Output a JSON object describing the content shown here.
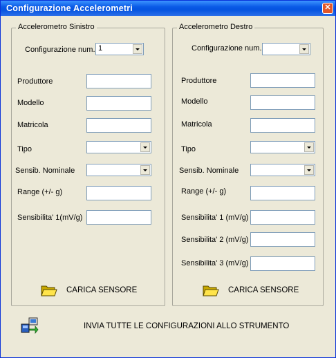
{
  "window": {
    "title": "Configurazione Accelerometri",
    "close_glyph": "✕"
  },
  "left": {
    "legend": "Accelerometro Sinistro",
    "config_label": "Configurazione num.",
    "config_value": "1",
    "produttore_label": "Produttore",
    "modello_label": "Modello",
    "matricola_label": "Matricola",
    "tipo_label": "Tipo",
    "sensib_label": "Sensib. Nominale",
    "range_label": "Range (+/- g)",
    "sens1_label": "Sensibilita' 1(mV/g)",
    "load_label": "CARICA SENSORE"
  },
  "right": {
    "legend": "Accelerometro Destro",
    "config_label": "Configurazione num.",
    "config_value": "",
    "produttore_label": "Produttore",
    "modello_label": "Modello",
    "matricola_label": "Matricola",
    "tipo_label": "Tipo",
    "sensib_label": "Sensib. Nominale",
    "range_label": "Range (+/- g)",
    "sens1_label": "Sensibilita' 1 (mV/g)",
    "sens2_label": "Sensibilita' 2 (mV/g)",
    "sens3_label": "Sensibilita' 3 (mV/g)",
    "load_label": "CARICA SENSORE"
  },
  "send_label": "INVIA TUTTE LE CONFIGURAZIONI ALLO STRUMENTO",
  "icons": {
    "load": "folder-open-icon",
    "send": "send-to-device-icon"
  },
  "colors": {
    "titlebar": "#0a5ae6",
    "window_bg": "#ece9d8",
    "field_border": "#7f9db9",
    "close": "#e2572a"
  }
}
